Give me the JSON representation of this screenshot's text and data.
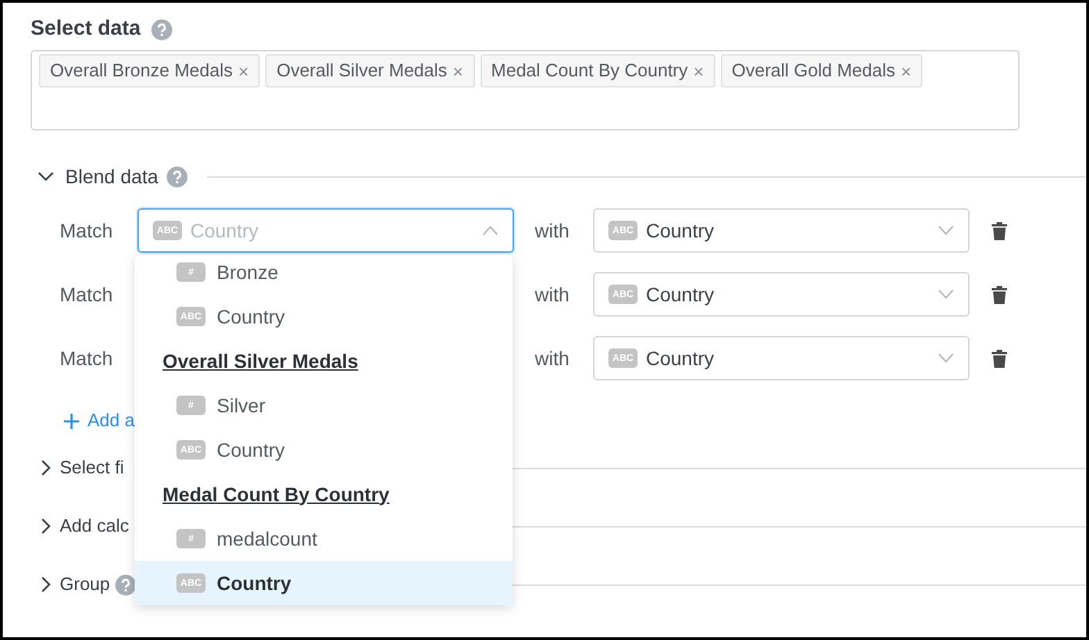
{
  "select_data": {
    "title": "Select data",
    "tags": [
      {
        "label": "Overall Bronze Medals",
        "remove": "×"
      },
      {
        "label": "Overall Silver Medals",
        "remove": "×"
      },
      {
        "label": "Medal Count By Country",
        "remove": "×"
      },
      {
        "label": "Overall Gold Medals",
        "remove": "×"
      }
    ]
  },
  "blend_data": {
    "title": "Blend data",
    "expanded": true,
    "matches": [
      {
        "label": "Match",
        "left": {
          "type": "ABC",
          "placeholder": "Country",
          "focused": true
        },
        "with": "with",
        "right": {
          "type": "ABC",
          "value": "Country"
        }
      },
      {
        "label": "Match",
        "with": "with",
        "right": {
          "type": "ABC",
          "value": "Country"
        }
      },
      {
        "label": "Match",
        "with": "with",
        "right": {
          "type": "ABC",
          "value": "Country"
        }
      }
    ],
    "add_link": "Add a"
  },
  "dropdown": [
    {
      "kind": "field",
      "type": "#",
      "label": "Bronze",
      "selected": false
    },
    {
      "kind": "field",
      "type": "ABC",
      "label": "Country",
      "selected": false
    },
    {
      "kind": "group",
      "label": "Overall Silver Medals"
    },
    {
      "kind": "field",
      "type": "#",
      "label": "Silver",
      "selected": false
    },
    {
      "kind": "field",
      "type": "ABC",
      "label": "Country",
      "selected": false
    },
    {
      "kind": "group",
      "label": "Medal Count By Country"
    },
    {
      "kind": "field",
      "type": "#",
      "label": "medalcount",
      "selected": false
    },
    {
      "kind": "field",
      "type": "ABC",
      "label": "Country",
      "selected": true
    }
  ],
  "sections": [
    {
      "title": "Select fi",
      "expanded": false,
      "help": false
    },
    {
      "title": "Add calc",
      "expanded": false,
      "help": false
    },
    {
      "title": "Group",
      "expanded": false,
      "help": true
    }
  ]
}
